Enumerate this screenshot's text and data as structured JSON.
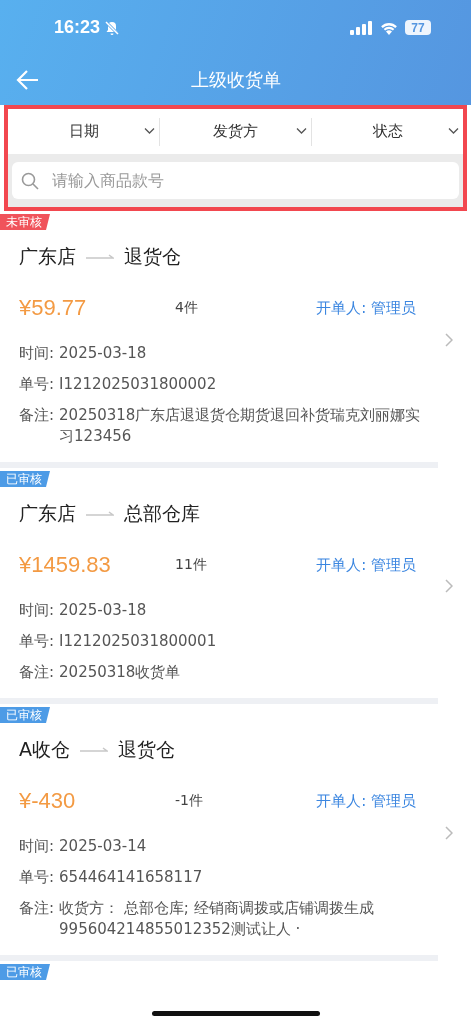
{
  "status_bar": {
    "time": "16:23",
    "battery": "77"
  },
  "header": {
    "title": "上级收货单"
  },
  "filters": [
    {
      "label": "日期"
    },
    {
      "label": "发货方"
    },
    {
      "label": "状态"
    }
  ],
  "search": {
    "placeholder": "请输入商品款号"
  },
  "orders": [
    {
      "status": {
        "kind": "pending",
        "label": "未审核"
      },
      "from": "广东店",
      "to": "退货仓",
      "amount": "¥59.77",
      "count": "4件",
      "creator": "开单人: 管理员",
      "time_label": "时间:",
      "time": "2025-03-18",
      "number_label": "单号:",
      "number": "I1212025031800002",
      "note_label": "备注:",
      "note": "20250318广东店退退货仓期货退回补货瑞克刘丽娜实习123456"
    },
    {
      "status": {
        "kind": "approved",
        "label": "已审核"
      },
      "from": "广东店",
      "to": "总部仓库",
      "amount": "¥1459.83",
      "count": "11件",
      "creator": "开单人: 管理员",
      "time_label": "时间:",
      "time": "2025-03-18",
      "number_label": "单号:",
      "number": "I1212025031800001",
      "note_label": "备注:",
      "note": "20250318收货单"
    },
    {
      "status": {
        "kind": "approved",
        "label": "已审核"
      },
      "from": "A收仓",
      "to": "退货仓",
      "amount": "¥-430",
      "count": "-1件",
      "creator": "开单人: 管理员",
      "time_label": "时间:",
      "time": "2025-03-14",
      "number_label": "单号:",
      "number": "654464141658117",
      "note_label": "备注:",
      "note": "收货方： 总部仓库; 经销商调拨或店铺调拨生成995604214855012352测试让人 ·"
    },
    {
      "status": {
        "kind": "approved",
        "label": "已审核"
      }
    }
  ]
}
